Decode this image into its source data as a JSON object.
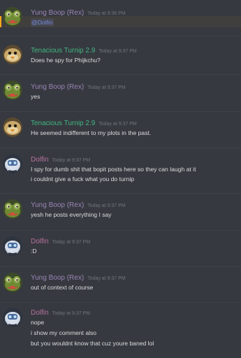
{
  "colors": {
    "background": "#36393f",
    "text": "#dcddde",
    "timestamp": "#72767d",
    "mention": "#7289da",
    "mention_highlight": "#faa61a"
  },
  "users": {
    "rex": {
      "name": "Yung Boop (Rex)",
      "color": "#9b84b7",
      "avatar_icon": "frog-avatar-icon"
    },
    "turnip": {
      "name": "Tenacious Turnip 2.9",
      "color": "#43b581",
      "avatar_icon": "bird-avatar-icon"
    },
    "dolfin": {
      "name": "Dolfin",
      "color": "#b9729e",
      "avatar_icon": "robot-avatar-icon"
    }
  },
  "messages": [
    {
      "author": "Yung Boop (Rex)",
      "time": "Today at 9:36 PM",
      "lines": [
        "@Dolfin"
      ]
    },
    {
      "author": "Tenacious Turnip 2.9",
      "time": "Today at 9:37 PM",
      "lines": [
        "Does he spy for Phijkchu?"
      ]
    },
    {
      "author": "Yung Boop (Rex)",
      "time": "Today at 9:37 PM",
      "lines": [
        "yes"
      ]
    },
    {
      "author": "Tenacious Turnip 2.9",
      "time": "Today at 9:37 PM",
      "lines": [
        "He seemed indifferent to my plots in the past."
      ]
    },
    {
      "author": "Dolfin",
      "time": "Today at 9:37 PM",
      "lines": [
        "I spy for dumb shit that bopit posts here so they can laugh at it",
        "i couldnt give a fuck what you do turnip"
      ]
    },
    {
      "author": "Yung Boop (Rex)",
      "time": "Today at 9:37 PM",
      "lines": [
        "yesh he posts everything I say"
      ]
    },
    {
      "author": "Dolfin",
      "time": "Today at 9:37 PM",
      "lines": [
        ":D"
      ]
    },
    {
      "author": "Yung Boop (Rex)",
      "time": "Today at 9:37 PM",
      "lines": [
        "out of context of course"
      ]
    },
    {
      "author": "Dolfin",
      "time": "Today at 9:37 PM",
      "lines": [
        "nope",
        "i show my comment also",
        "but you wouldnt know that cuz youre baned lol"
      ]
    }
  ]
}
